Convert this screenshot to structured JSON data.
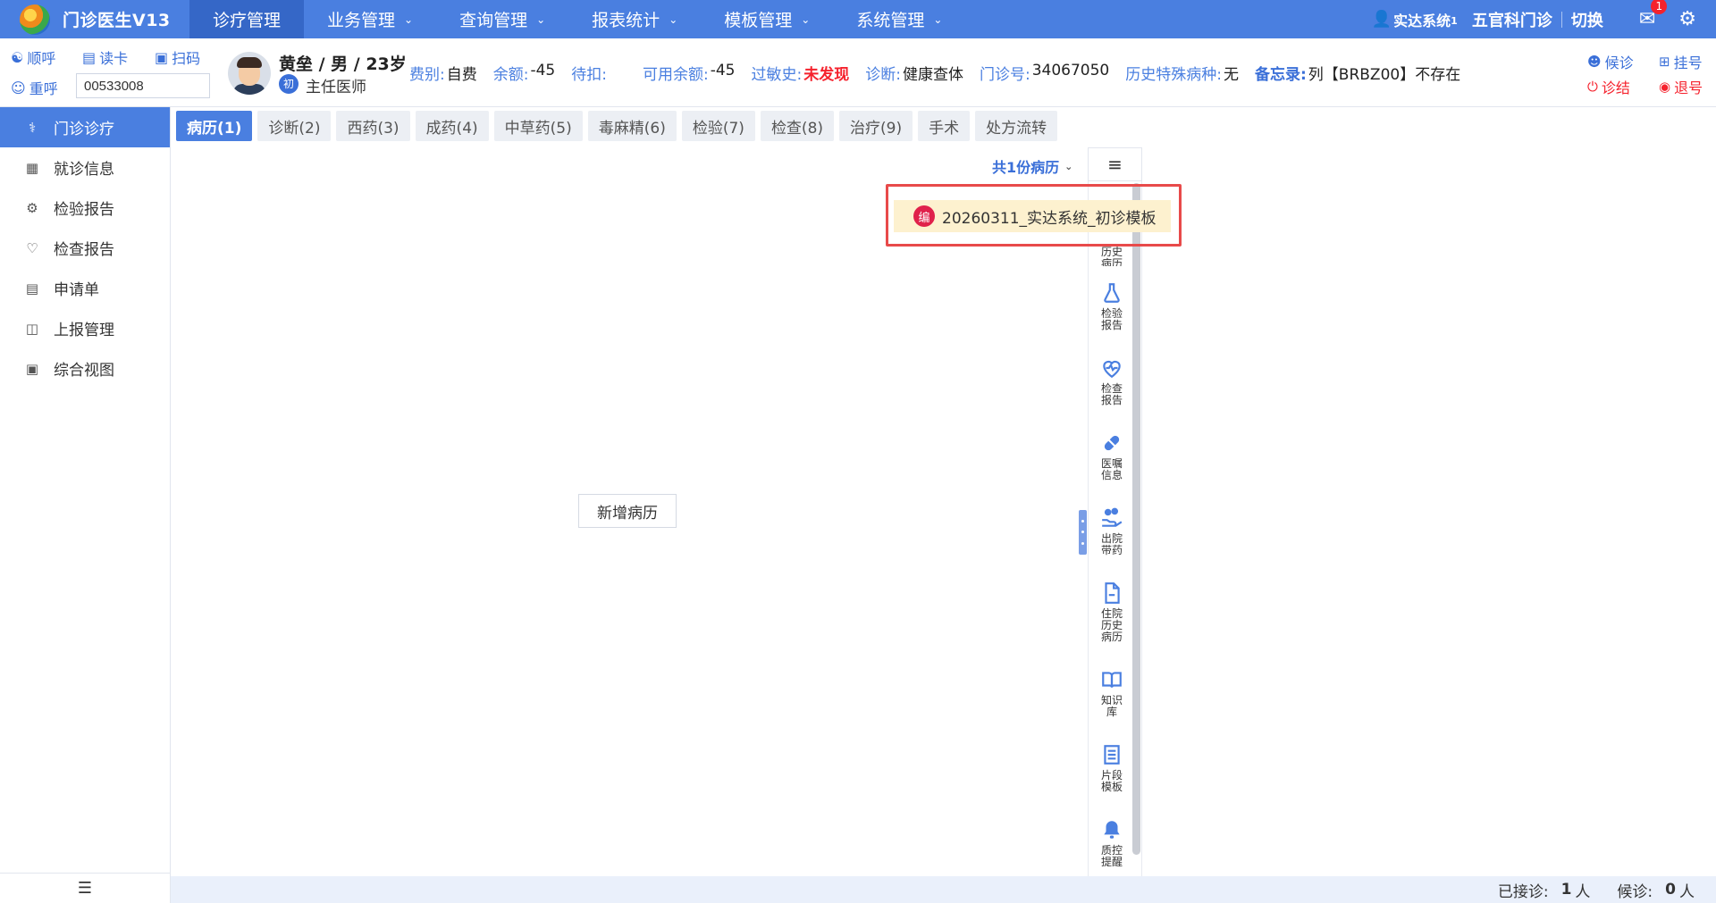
{
  "app": {
    "title": "门诊医生V13"
  },
  "nav": {
    "items": [
      {
        "label": "诊疗管理"
      },
      {
        "label": "业务管理"
      },
      {
        "label": "查询管理"
      },
      {
        "label": "报表统计"
      },
      {
        "label": "模板管理"
      },
      {
        "label": "系统管理"
      }
    ]
  },
  "topright": {
    "user": "实达系统",
    "user_sub": "1",
    "dept": "五官科门诊",
    "switch_label": "切换",
    "mail_count": "1"
  },
  "quick_actions": {
    "call_next": "顺呼",
    "read_card": "读卡",
    "scan": "扫码",
    "recall": "重呼",
    "card_number": "00533008"
  },
  "patient": {
    "name_line": "黄垒 / 男 / 23岁",
    "visit_badge": "初",
    "doctor": "主任医师",
    "fields": [
      {
        "k": "费别:",
        "v": "自费"
      },
      {
        "k": "余额:",
        "v": "-45"
      },
      {
        "k": "待扣:",
        "v": ""
      },
      {
        "k": "可用余额:",
        "v": "-45"
      },
      {
        "k": "过敏史:",
        "v": "未发现"
      },
      {
        "k": "诊断:",
        "v": "健康查体"
      },
      {
        "k": "门诊号:",
        "v": "34067050"
      },
      {
        "k": "历史特殊病种:",
        "v": "无"
      },
      {
        "k": "备忘录:",
        "v": "列【BRBZ00】不存在"
      }
    ]
  },
  "right_actions": {
    "wait": "候诊",
    "register": "挂号",
    "finish": "诊结",
    "refund": "退号"
  },
  "sidebar": {
    "items": [
      {
        "label": "门诊诊疗"
      },
      {
        "label": "就诊信息"
      },
      {
        "label": "检验报告"
      },
      {
        "label": "检查报告"
      },
      {
        "label": "申请单"
      },
      {
        "label": "上报管理"
      },
      {
        "label": "综合视图"
      }
    ]
  },
  "tabs": [
    {
      "label": "病历(1)"
    },
    {
      "label": "诊断(2)"
    },
    {
      "label": "西药(3)"
    },
    {
      "label": "成药(4)"
    },
    {
      "label": "中草药(5)"
    },
    {
      "label": "毒麻精(6)"
    },
    {
      "label": "检验(7)"
    },
    {
      "label": "检查(8)"
    },
    {
      "label": "治疗(9)"
    },
    {
      "label": "手术"
    },
    {
      "label": "处方流转"
    }
  ],
  "content": {
    "record_count": "共1份病历",
    "add_record": "新增病历",
    "dropdown_badge": "编",
    "dropdown_item": "20260311_实达系统_初诊模板"
  },
  "rail": {
    "partial_label": "历史病历",
    "items": [
      {
        "label": "检验报告",
        "icon": "flask-icon"
      },
      {
        "label": "检查报告",
        "icon": "heart-pulse-icon"
      },
      {
        "label": "医嘱信息",
        "icon": "pill-icon"
      },
      {
        "label": "出院带药",
        "icon": "hand-medicine-icon"
      },
      {
        "label": "住院历史病历",
        "icon": "document-icon"
      },
      {
        "label": "知识库",
        "icon": "book-icon"
      },
      {
        "label": "片段模板",
        "icon": "list-doc-icon"
      },
      {
        "label": "质控提醒",
        "icon": "bell-icon"
      }
    ]
  },
  "status": {
    "received_label": "已接诊:",
    "received_value": "1",
    "received_unit": "人",
    "waiting_label": "候诊:",
    "waiting_value": "0",
    "waiting_unit": "人"
  },
  "colors": {
    "primary": "#4a7fe0",
    "nav_active": "#3567c7",
    "danger": "#f5222d",
    "highlight": "#fdf1cf"
  }
}
